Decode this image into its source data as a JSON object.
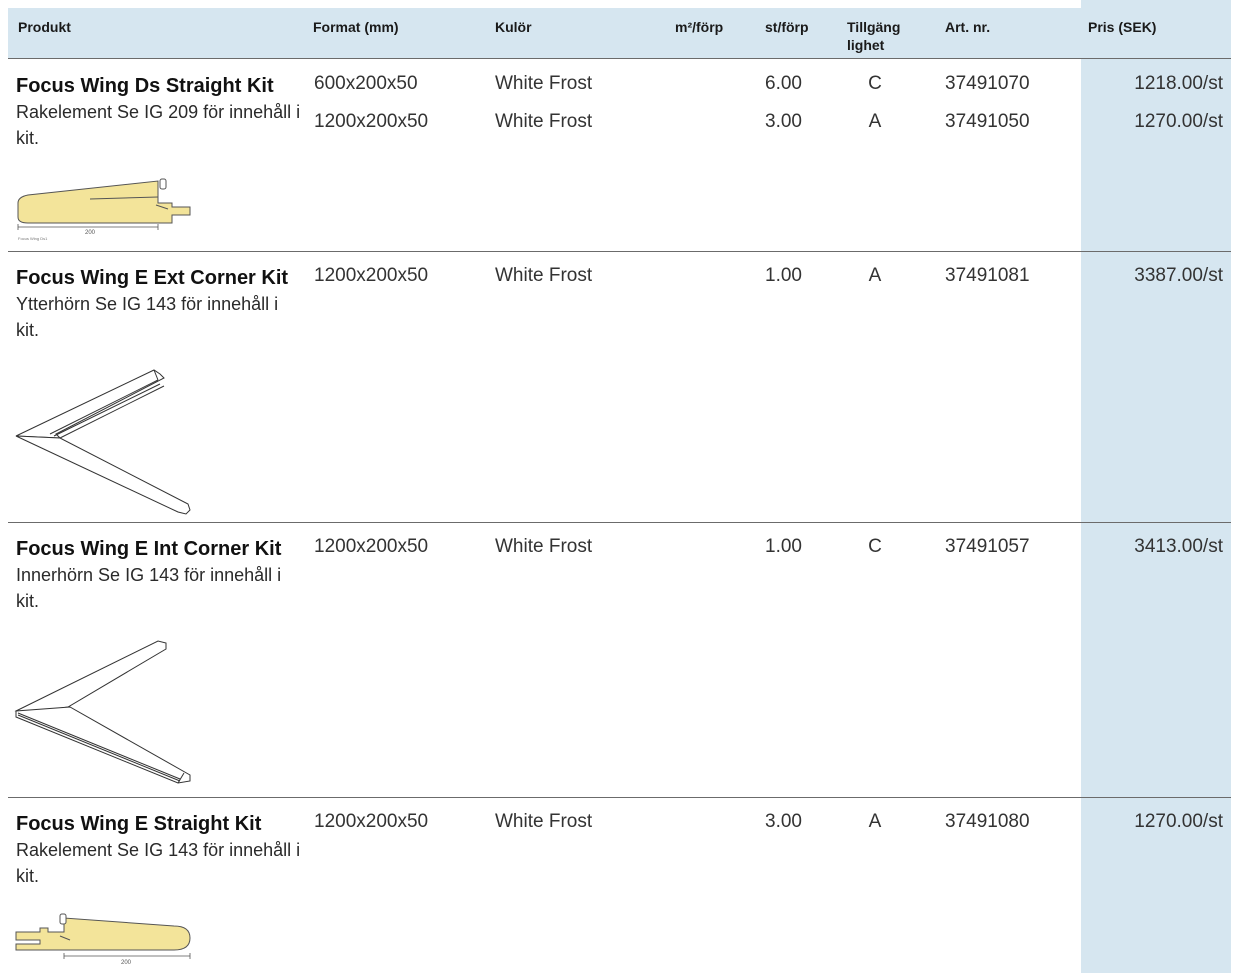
{
  "header": {
    "produkt": "Produkt",
    "format": "Format (mm)",
    "kulor": "Kulör",
    "m2": "m²/förp",
    "st": "st/förp",
    "tillg1": "Tillgäng",
    "tillg2": "lighet",
    "art": "Art. nr.",
    "pris": "Pris (SEK)"
  },
  "products": [
    {
      "name": "Focus Wing Ds Straight Kit",
      "desc": "Rakelement Se IG 209 för innehåll i kit.",
      "drawing_label_dim": "200",
      "drawing_label_name": "Focus Wing Ds1",
      "variants": [
        {
          "format": "600x200x50",
          "color": "White Frost",
          "st": "6.00",
          "avail": "C",
          "art": "37491070",
          "price": "1218.00/st"
        },
        {
          "format": "1200x200x50",
          "color": "White Frost",
          "st": "3.00",
          "avail": "A",
          "art": "37491050",
          "price": "1270.00/st"
        }
      ]
    },
    {
      "name": "Focus Wing E Ext Corner Kit",
      "desc": "Ytterhörn Se IG 143 för innehåll i kit.",
      "variants": [
        {
          "format": "1200x200x50",
          "color": "White Frost",
          "st": "1.00",
          "avail": "A",
          "art": "37491081",
          "price": "3387.00/st"
        }
      ]
    },
    {
      "name": "Focus Wing E Int Corner Kit",
      "desc": "Innerhörn Se IG 143 för innehåll i kit.",
      "variants": [
        {
          "format": "1200x200x50",
          "color": "White Frost",
          "st": "1.00",
          "avail": "C",
          "art": "37491057",
          "price": "3413.00/st"
        }
      ]
    },
    {
      "name": "Focus Wing E Straight Kit",
      "desc": "Rakelement Se IG 143 för innehåll i kit.",
      "drawing_label_dim": "200",
      "variants": [
        {
          "format": "1200x200x50",
          "color": "White Frost",
          "st": "3.00",
          "avail": "A",
          "art": "37491080",
          "price": "1270.00/st"
        }
      ]
    }
  ],
  "colors": {
    "header_bg": "#d6e6f0",
    "price_band": "#d6e6f0",
    "panel_fill": "#f3e49a",
    "line": "#6b6b6b"
  }
}
